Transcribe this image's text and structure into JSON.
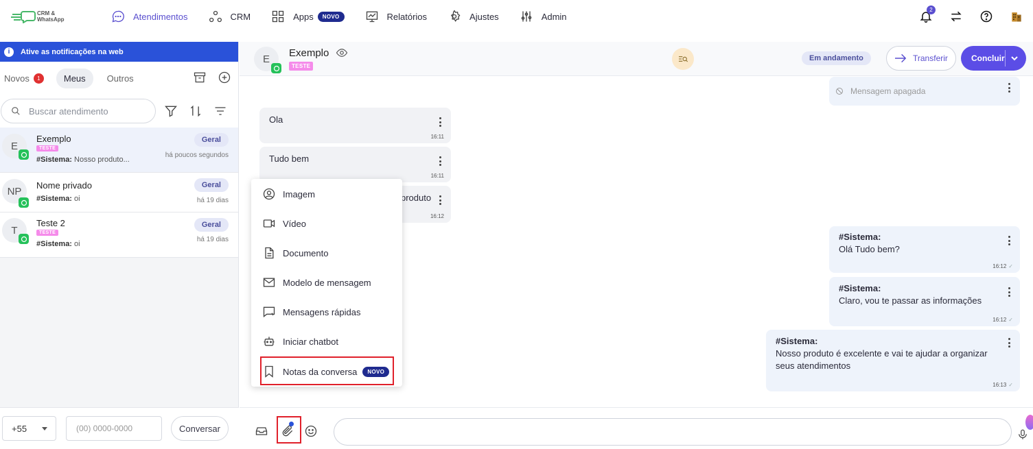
{
  "app": {
    "logo_line1": "CRM &",
    "logo_line2": "WhatsApp"
  },
  "nav": {
    "items": [
      {
        "label": "Atendimentos",
        "icon": "chat-bubble-icon",
        "active": true
      },
      {
        "label": "CRM",
        "icon": "network-icon"
      },
      {
        "label": "Apps",
        "icon": "grid-icon",
        "badge": "NOVO"
      },
      {
        "label": "Relatórios",
        "icon": "chart-icon"
      },
      {
        "label": "Ajustes",
        "icon": "gear-icon"
      },
      {
        "label": "Admin",
        "icon": "sliders-icon"
      }
    ],
    "notification_count": "2"
  },
  "sidebar": {
    "notice": "Ative as notificações na web",
    "tabs": [
      {
        "label": "Novos",
        "count": "1"
      },
      {
        "label": "Meus"
      },
      {
        "label": "Outros"
      }
    ],
    "search_placeholder": "Buscar atendimento",
    "conversations": [
      {
        "initials": "E",
        "name": "Exemplo",
        "tag": "TESTE",
        "preview_prefix": "#Sistema:",
        "preview": " Nosso produto...",
        "queue": "Geral",
        "time": "há poucos segundos"
      },
      {
        "initials": "NP",
        "name": "Nome privado",
        "tag": "",
        "preview_prefix": "#Sistema:",
        "preview": " oi",
        "queue": "Geral",
        "time": "há 19 dias"
      },
      {
        "initials": "T",
        "name": "Teste 2",
        "tag": "TESTE",
        "preview_prefix": "#Sistema:",
        "preview": " oi",
        "queue": "Geral",
        "time": "há 19 dias"
      }
    ],
    "country_code": "+55",
    "phone_placeholder": "(00) 0000-0000",
    "start_button": "Conversar"
  },
  "chat": {
    "contact_initial": "E",
    "contact_name": "Exemplo",
    "contact_tag": "TESTE",
    "status": "Em andamento",
    "transfer_label": "Transferir",
    "finish_label": "Concluir",
    "messages": [
      {
        "side": "out",
        "text": "Mensagem apagada",
        "deleted": true
      },
      {
        "side": "in",
        "text": "Ola",
        "time": "16:11"
      },
      {
        "side": "in",
        "text": "Tudo bem",
        "time": "16:11"
      },
      {
        "side": "in",
        "text": "produto",
        "time": "16:12"
      },
      {
        "side": "out",
        "sender": "#Sistema:",
        "text": "Olá Tudo bem?",
        "time": "16:12"
      },
      {
        "side": "out",
        "sender": "#Sistema:",
        "text": "Claro, vou te passar as informações",
        "time": "16:12"
      },
      {
        "side": "out",
        "sender": "#Sistema:",
        "text": "Nosso produto é excelente e vai te ajudar a organizar seus atendimentos",
        "time": "16:13"
      }
    ]
  },
  "attach_menu": {
    "items": [
      {
        "label": "Imagem",
        "icon": "image-icon"
      },
      {
        "label": "Vídeo",
        "icon": "video-icon"
      },
      {
        "label": "Documento",
        "icon": "document-icon"
      },
      {
        "label": "Modelo de mensagem",
        "icon": "envelope-icon"
      },
      {
        "label": "Mensagens rápidas",
        "icon": "quick-message-icon"
      },
      {
        "label": "Iniciar chatbot",
        "icon": "bot-icon"
      },
      {
        "label": "Notas da conversa",
        "icon": "bookmark-icon",
        "badge": "NOVO"
      }
    ]
  },
  "colors": {
    "accent": "#5a4fcf",
    "primary_button": "#5b4de6",
    "notice_bar": "#2a52d9",
    "badge_red": "#e03131",
    "highlight_red": "#e0202a",
    "whatsapp_green": "#25c15a",
    "tag_pink": "#f58bea"
  }
}
